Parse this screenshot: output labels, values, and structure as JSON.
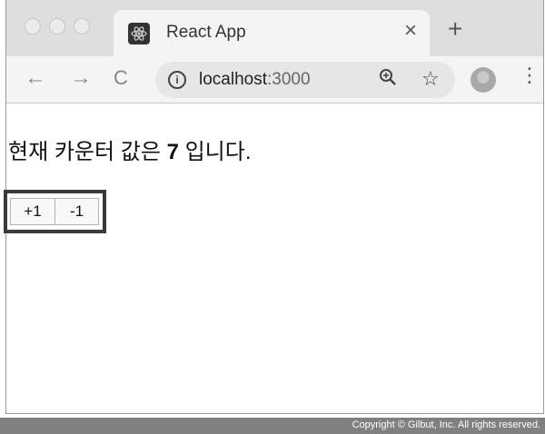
{
  "browser": {
    "tab_title": "React App",
    "tab_close": "×",
    "new_tab": "+",
    "url_host": "localhost",
    "url_port": ":3000",
    "back": "←",
    "forward": "→",
    "reload": "C",
    "menu": "⋮"
  },
  "page": {
    "counter_prefix": "현재 카운터 값은 ",
    "counter_value": "7",
    "counter_suffix": " 입니다.",
    "increment_label": "+1",
    "decrement_label": "-1"
  },
  "footer": {
    "copyright": "Copyright © Gilbut, Inc. All rights reserved."
  },
  "icons": {
    "favicon": "react-logo-icon",
    "site_info": "info-icon",
    "zoom": "zoom-in-icon",
    "bookmark": "star-icon",
    "profile": "avatar-icon"
  }
}
